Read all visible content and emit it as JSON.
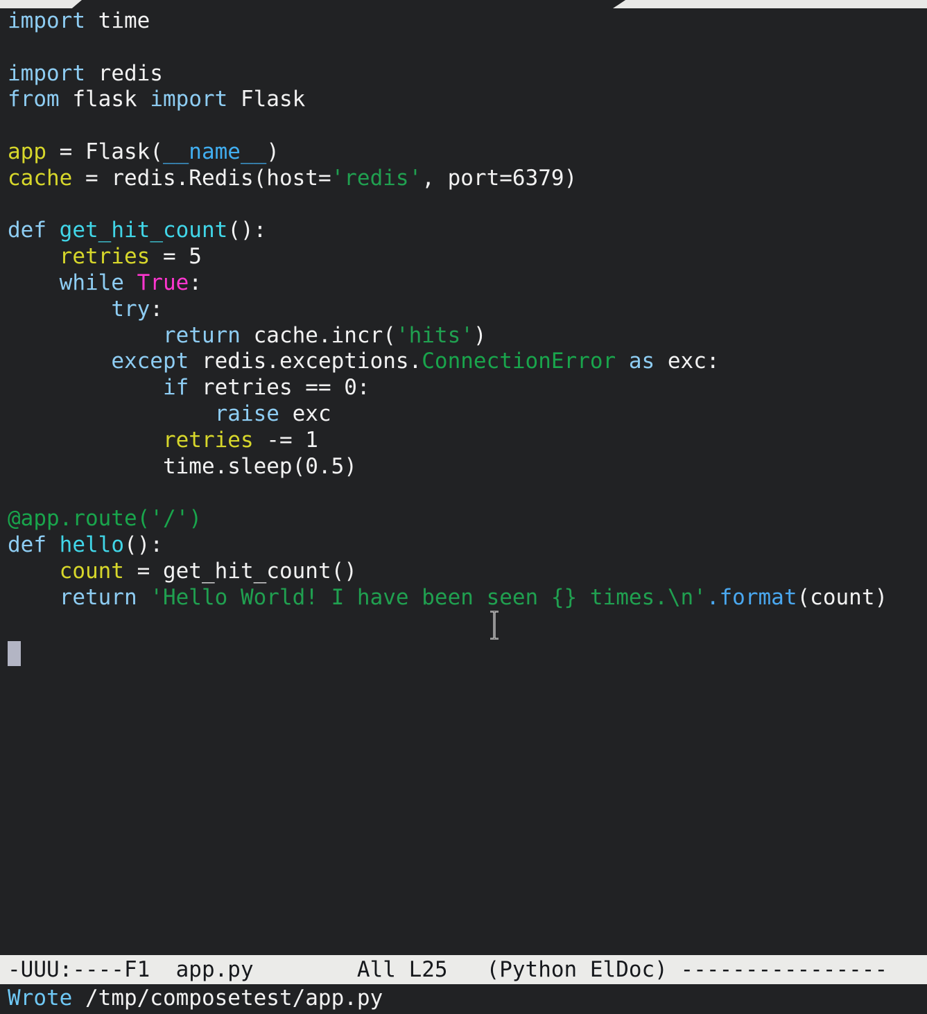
{
  "window": {
    "app": "GNU Emacs",
    "background": "#212224",
    "foreground": "#f2f2f2"
  },
  "tab_line": {
    "visible": true,
    "chip_color": "#e8e8e6",
    "left_tab_label": "",
    "right_tab_label": ""
  },
  "buffer": {
    "file_name": "app.py",
    "major_mode": "Python",
    "minor_modes": "ElDoc",
    "language": "python",
    "cursor_line": 25,
    "cursor_column": 0,
    "code": "import time\n\nimport redis\nfrom flask import Flask\n\napp = Flask(__name__)\ncache = redis.Redis(host='redis', port=6379)\n\ndef get_hit_count():\n    retries = 5\n    while True:\n        try:\n            return cache.incr('hits')\n        except redis.exceptions.ConnectionError as exc:\n            if retries == 0:\n                raise exc\n            retries -= 1\n            time.sleep(0.5)\n\n@app.route('/')\ndef hello():\n    count = get_hit_count()\n    return 'Hello World! I have been seen {} times.\\n'.format(count)\n",
    "lines": [
      {
        "n": 1,
        "text": "import time"
      },
      {
        "n": 2,
        "text": ""
      },
      {
        "n": 3,
        "text": "import redis"
      },
      {
        "n": 4,
        "text": "from flask import Flask"
      },
      {
        "n": 5,
        "text": ""
      },
      {
        "n": 6,
        "text": "app = Flask(__name__)"
      },
      {
        "n": 7,
        "text": "cache = redis.Redis(host='redis', port=6379)"
      },
      {
        "n": 8,
        "text": ""
      },
      {
        "n": 9,
        "text": "def get_hit_count():"
      },
      {
        "n": 10,
        "text": "    retries = 5"
      },
      {
        "n": 11,
        "text": "    while True:"
      },
      {
        "n": 12,
        "text": "        try:"
      },
      {
        "n": 13,
        "text": "            return cache.incr('hits')"
      },
      {
        "n": 14,
        "text": "        except redis.exceptions.ConnectionError as exc:"
      },
      {
        "n": 15,
        "text": "            if retries == 0:"
      },
      {
        "n": 16,
        "text": "                raise exc"
      },
      {
        "n": 17,
        "text": "            retries -= 1"
      },
      {
        "n": 18,
        "text": "            time.sleep(0.5)"
      },
      {
        "n": 19,
        "text": ""
      },
      {
        "n": 20,
        "text": "@app.route('/')"
      },
      {
        "n": 21,
        "text": "def hello():"
      },
      {
        "n": 22,
        "text": "    count = get_hit_count()"
      },
      {
        "n": 23,
        "text": "    return 'Hello World! I have been seen {} times.\\n'.format(count)"
      },
      {
        "n": 24,
        "text": ""
      },
      {
        "n": 25,
        "text": ""
      }
    ]
  },
  "syntax_colors": {
    "keyword": "#8ecdf3",
    "function_name": "#41d6e8",
    "variable": "#d7d72b",
    "string": "#20a050",
    "decorator": "#19a54c",
    "builtin_constant": "#ff36cf",
    "type": "#19a54c",
    "dunder": "#41aef0",
    "method": "#4aa8f0",
    "plain": "#f2f2f2",
    "cursor": "#b3b5c4"
  },
  "mode_line": {
    "background": "#ebebe9",
    "foreground": "#16181c",
    "mode_string": "-UUU:----F1",
    "buffer_name": "app.py",
    "position": "All",
    "line_indicator": "L25",
    "modes": "(Python ElDoc)",
    "filler": "----------------",
    "full_text": "-UUU:----F1  app.py        All L25   (Python ElDoc) ----------------"
  },
  "echo_area": {
    "prefix": "Wrote",
    "path": " /tmp/composetest/app.py",
    "message": "Wrote /tmp/composetest/app.py"
  }
}
